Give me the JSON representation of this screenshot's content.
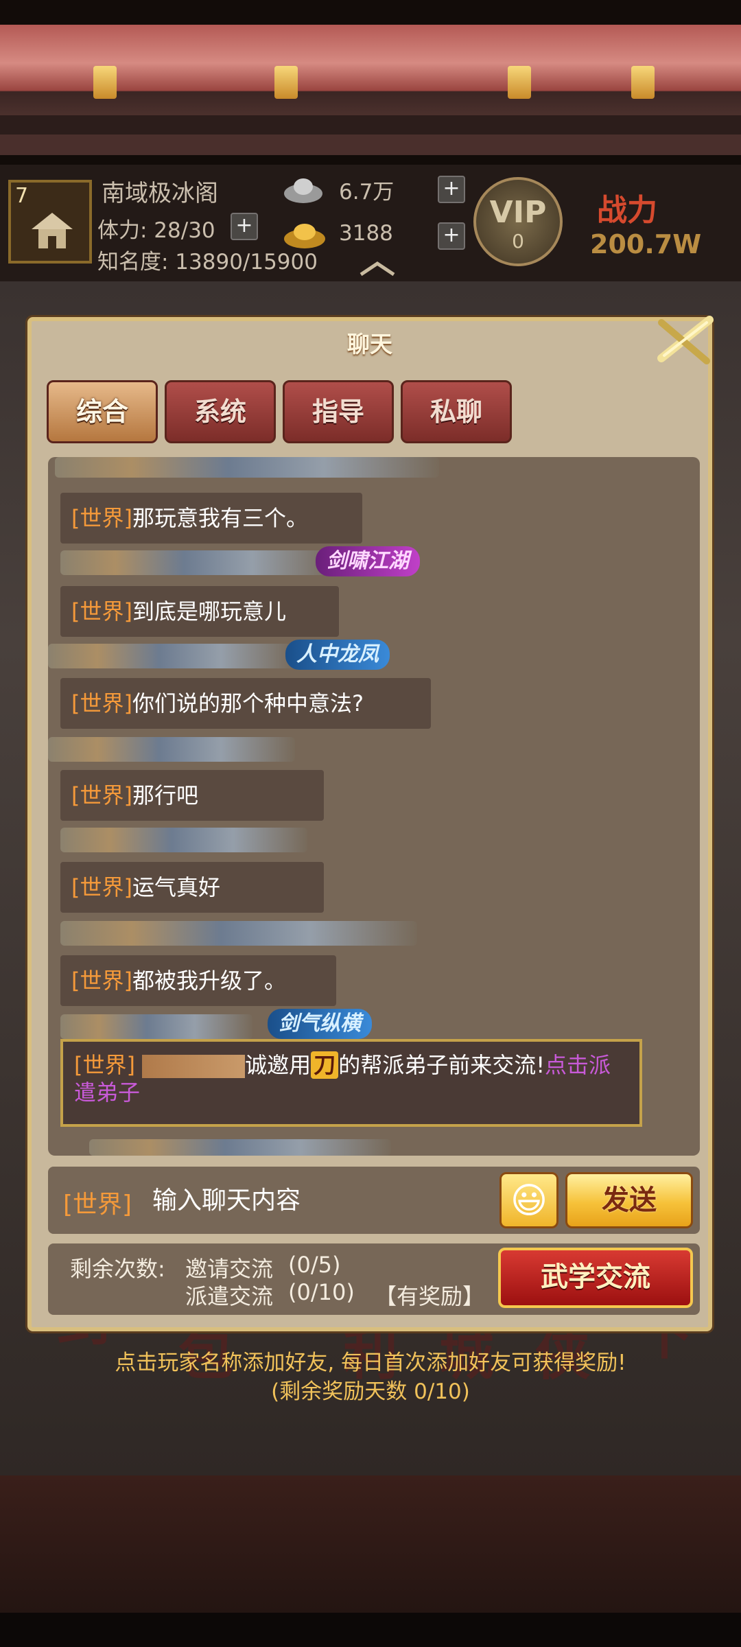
{
  "header": {
    "level": "7",
    "guild_name": "南域极冰阁",
    "stamina": "体力: 28/30",
    "fame": "知名度: 13890/15900",
    "silver": "6.7万",
    "gold": "3188",
    "vip_label": "VIP",
    "vip_level": "0",
    "power_label": "战力",
    "power_value": "200.7W"
  },
  "dialog": {
    "title": "聊天",
    "tabs": [
      {
        "label": "综合",
        "active": true
      },
      {
        "label": "系统",
        "active": false
      },
      {
        "label": "指导",
        "active": false
      },
      {
        "label": "私聊",
        "active": false
      }
    ]
  },
  "chat": {
    "badges": [
      "剑啸江湖",
      "人中龙凤",
      "剑气纵横"
    ],
    "messages": [
      {
        "tag": "[世界]",
        "text": "那玩意我有三个。"
      },
      {
        "tag": "[世界]",
        "text": "到底是哪玩意儿"
      },
      {
        "tag": "[世界]",
        "text": "你们说的那个种中意法?"
      },
      {
        "tag": "[世界]",
        "text": "那行吧"
      },
      {
        "tag": "[世界]",
        "text": "运气真好"
      },
      {
        "tag": "[世界]",
        "text": "都被我升级了。"
      }
    ],
    "invite": {
      "tag": "[世界]",
      "text_a": "诚邀用",
      "weapon_glyph": "刀",
      "text_b": "的帮派弟子前来交流!",
      "link": "点击派遣弟子"
    }
  },
  "input": {
    "channel": "[世界]",
    "placeholder": "输入聊天内容",
    "emoji": "😃",
    "send_label": "发送"
  },
  "exchange": {
    "remaining_label": "剩余次数:",
    "invite_label": "邀请交流",
    "invite_count": "(0/5)",
    "dispatch_label": "派遣交流",
    "dispatch_count": "(0/10)",
    "reward_tag": "【有奖励】",
    "button_label": "武学交流"
  },
  "footer": {
    "hint_line1": "点击玩家名称添加好友, 每日首次添加好友可获得奖励!",
    "hint_line2": "(剩余奖励天数 0/10)"
  },
  "colors": {
    "channel_tag": "#f59a3a",
    "link": "#c85ad8",
    "hint": "#f1c25a"
  }
}
